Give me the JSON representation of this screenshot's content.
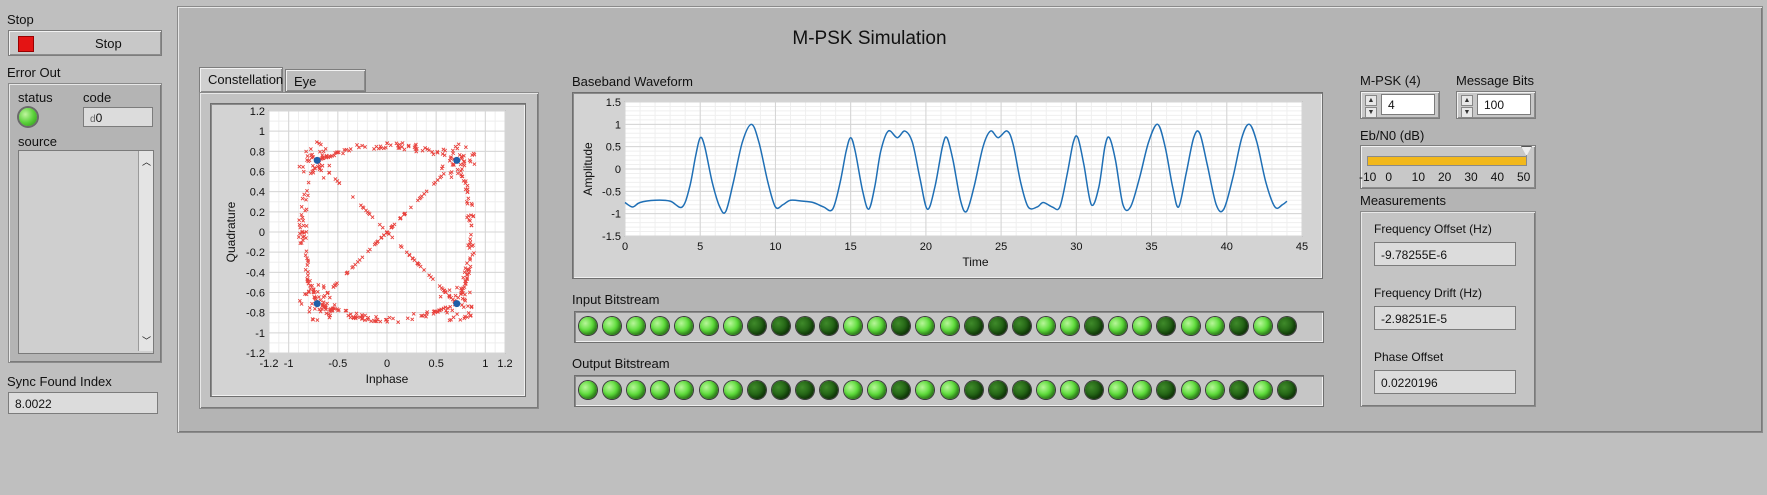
{
  "stop": {
    "label": "Stop",
    "button_label": "Stop"
  },
  "error_out": {
    "label": "Error Out",
    "status_label": "status",
    "code_label": "code",
    "code_value": "0",
    "code_prefix": "d",
    "source_label": "source"
  },
  "sync_found": {
    "label": "Sync Found Index",
    "value": "8.0022"
  },
  "title": "M-PSK Simulation",
  "tabs": [
    {
      "label": "Constellation"
    },
    {
      "label": "Eye Diagram"
    }
  ],
  "constellation_chart": {
    "chart_data": {
      "type": "scatter",
      "xlabel": "Inphase",
      "ylabel": "Quadrature",
      "xlim": [
        -1.2,
        1.2
      ],
      "ylim": [
        -1.2,
        1.2
      ],
      "x_ticks": [
        "-1.2",
        "-1",
        "-0.5",
        "0",
        "0.5",
        "1",
        "1.2"
      ],
      "y_ticks": [
        "1.2",
        "1",
        "0.8",
        "0.6",
        "0.4",
        "0.2",
        "0",
        "-0.2",
        "-0.4",
        "-0.6",
        "-0.8",
        "-1",
        "-1.2"
      ],
      "symbol_points": [
        [
          0.71,
          0.71
        ],
        [
          -0.71,
          0.71
        ],
        [
          -0.71,
          -0.71
        ],
        [
          0.71,
          -0.71
        ]
      ],
      "colors": {
        "trajectory": "#e8413c",
        "symbols": "#1f5fa8"
      }
    }
  },
  "waveform_chart": {
    "label": "Baseband Waveform",
    "chart_data": {
      "type": "line",
      "xlabel": "Time",
      "ylabel": "Amplitude",
      "xlim": [
        0,
        45
      ],
      "ylim": [
        -1.5,
        1.5
      ],
      "x_ticks": [
        "0",
        "5",
        "10",
        "15",
        "20",
        "25",
        "30",
        "35",
        "40",
        "45"
      ],
      "y_ticks": [
        "1.5",
        "1",
        "0.5",
        "0",
        "-0.5",
        "-1",
        "-1.5"
      ],
      "series": [
        {
          "points": [
            [
              0,
              -0.75
            ],
            [
              0.5,
              -0.85
            ],
            [
              1,
              -0.75
            ],
            [
              2,
              -0.7
            ],
            [
              3,
              -0.72
            ],
            [
              3.8,
              -0.85
            ],
            [
              4.3,
              -0.4
            ],
            [
              4.7,
              0.3
            ],
            [
              5,
              0.7
            ],
            [
              5.3,
              0.5
            ],
            [
              5.8,
              -0.3
            ],
            [
              6.3,
              -0.85
            ],
            [
              6.7,
              -0.95
            ],
            [
              7.2,
              -0.3
            ],
            [
              7.8,
              0.6
            ],
            [
              8.4,
              1.0
            ],
            [
              8.9,
              0.6
            ],
            [
              9.5,
              -0.3
            ],
            [
              10,
              -0.85
            ],
            [
              10.5,
              -0.8
            ],
            [
              11,
              -0.7
            ],
            [
              11.8,
              -0.72
            ],
            [
              12.5,
              -0.75
            ],
            [
              13.2,
              -0.85
            ],
            [
              13.8,
              -0.9
            ],
            [
              14.3,
              -0.3
            ],
            [
              14.7,
              0.4
            ],
            [
              15,
              0.7
            ],
            [
              15.3,
              0.4
            ],
            [
              15.8,
              -0.5
            ],
            [
              16.2,
              -0.9
            ],
            [
              16.6,
              -0.4
            ],
            [
              17,
              0.4
            ],
            [
              17.5,
              0.85
            ],
            [
              18.1,
              0.7
            ],
            [
              18.6,
              0.85
            ],
            [
              19.1,
              0.6
            ],
            [
              19.6,
              -0.2
            ],
            [
              20.1,
              -0.9
            ],
            [
              20.6,
              -0.4
            ],
            [
              21.1,
              0.5
            ],
            [
              21.4,
              0.7
            ],
            [
              21.8,
              0.2
            ],
            [
              22.3,
              -0.7
            ],
            [
              22.7,
              -0.95
            ],
            [
              23.2,
              -0.4
            ],
            [
              23.8,
              0.5
            ],
            [
              24.3,
              0.85
            ],
            [
              24.8,
              0.7
            ],
            [
              25.4,
              0.85
            ],
            [
              25.8,
              0.55
            ],
            [
              26.3,
              -0.3
            ],
            [
              26.8,
              -0.85
            ],
            [
              27.4,
              -0.85
            ],
            [
              27.8,
              -0.75
            ],
            [
              28.4,
              -0.85
            ],
            [
              28.9,
              -0.85
            ],
            [
              29.4,
              -0.1
            ],
            [
              29.8,
              0.6
            ],
            [
              30.1,
              0.7
            ],
            [
              30.5,
              0.1
            ],
            [
              31,
              -0.8
            ],
            [
              31.5,
              -0.4
            ],
            [
              31.9,
              0.5
            ],
            [
              32.2,
              0.7
            ],
            [
              32.6,
              0.2
            ],
            [
              33.1,
              -0.8
            ],
            [
              33.6,
              -0.85
            ],
            [
              34.2,
              -0.2
            ],
            [
              34.8,
              0.6
            ],
            [
              35.4,
              1.0
            ],
            [
              35.9,
              0.5
            ],
            [
              36.4,
              -0.4
            ],
            [
              36.8,
              -0.85
            ],
            [
              37.3,
              -0.1
            ],
            [
              37.8,
              0.7
            ],
            [
              38.2,
              0.8
            ],
            [
              38.7,
              0.1
            ],
            [
              39.3,
              -0.8
            ],
            [
              39.8,
              -0.9
            ],
            [
              40.4,
              -0.2
            ],
            [
              41,
              0.7
            ],
            [
              41.5,
              1.0
            ],
            [
              42,
              0.6
            ],
            [
              42.6,
              -0.3
            ],
            [
              43.2,
              -0.85
            ],
            [
              43.7,
              -0.8
            ],
            [
              44,
              -0.72
            ]
          ]
        }
      ],
      "colors": {
        "line": "#1f6fb5"
      }
    }
  },
  "input_bitstream": {
    "label": "Input Bitstream",
    "bits": [
      1,
      1,
      1,
      1,
      1,
      1,
      1,
      0,
      0,
      0,
      0,
      1,
      1,
      0,
      1,
      1,
      0,
      0,
      0,
      1,
      1,
      0,
      1,
      1,
      0,
      1,
      1,
      0,
      1,
      0
    ]
  },
  "output_bitstream": {
    "label": "Output Bitstream",
    "bits": [
      1,
      1,
      1,
      1,
      1,
      1,
      1,
      0,
      0,
      0,
      0,
      1,
      1,
      0,
      1,
      1,
      0,
      0,
      0,
      1,
      1,
      0,
      1,
      1,
      0,
      1,
      1,
      0,
      1,
      0
    ]
  },
  "mpsk": {
    "label": "M-PSK (4)",
    "value": "4"
  },
  "message_bits": {
    "label": "Message Bits",
    "value": "100"
  },
  "ebn0": {
    "label": "Eb/N0 (dB)",
    "ticks": [
      "-10",
      "0",
      "10",
      "20",
      "30",
      "40",
      "50"
    ],
    "value_fraction": 1.0
  },
  "measurements": {
    "label": "Measurements",
    "freq_offset": {
      "label": "Frequency Offset (Hz)",
      "value": "-9.78255E-6"
    },
    "freq_drift": {
      "label": "Frequency Drift (Hz)",
      "value": "-2.98251E-5"
    },
    "phase_offset": {
      "label": "Phase Offset",
      "value": "0.0220196"
    }
  }
}
